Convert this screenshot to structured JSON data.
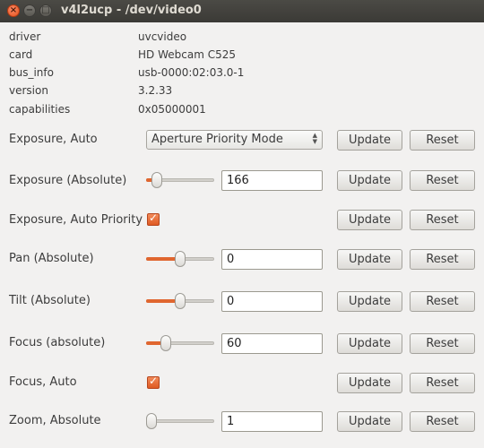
{
  "window": {
    "title": "v4l2ucp - /dev/video0",
    "close_glyph": "×",
    "minimize_glyph": "−",
    "maximize_glyph": "□"
  },
  "info": [
    {
      "key": "driver",
      "value": "uvcvideo"
    },
    {
      "key": "card",
      "value": "HD Webcam C525"
    },
    {
      "key": "bus_info",
      "value": "usb-0000:02:03.0-1"
    },
    {
      "key": "version",
      "value": "3.2.33"
    },
    {
      "key": "capabilities",
      "value": "0x05000001"
    }
  ],
  "buttons": {
    "update": "Update",
    "reset": "Reset"
  },
  "controls": {
    "exposure_auto": {
      "label": "Exposure, Auto",
      "selected": "Aperture Priority Mode"
    },
    "exposure_absolute": {
      "label": "Exposure (Absolute)",
      "value": "166",
      "slider_fraction": 0.1
    },
    "exposure_auto_priority": {
      "label": "Exposure, Auto Priority",
      "checked": true
    },
    "pan_absolute": {
      "label": "Pan (Absolute)",
      "value": "0",
      "slider_fraction": 0.5
    },
    "tilt_absolute": {
      "label": "Tilt (Absolute)",
      "value": "0",
      "slider_fraction": 0.5
    },
    "focus_absolute": {
      "label": "Focus (absolute)",
      "value": "60",
      "slider_fraction": 0.25
    },
    "focus_auto": {
      "label": "Focus, Auto",
      "checked": true
    },
    "zoom_absolute": {
      "label": "Zoom, Absolute",
      "value": "1",
      "slider_fraction": 0.0
    }
  },
  "colors": {
    "accent": "#e0662f",
    "titlebar": "#3c3b37",
    "background": "#f2f1f0"
  },
  "icons": {
    "combo_arrows": "up-down-arrows",
    "check": "checkmark"
  }
}
